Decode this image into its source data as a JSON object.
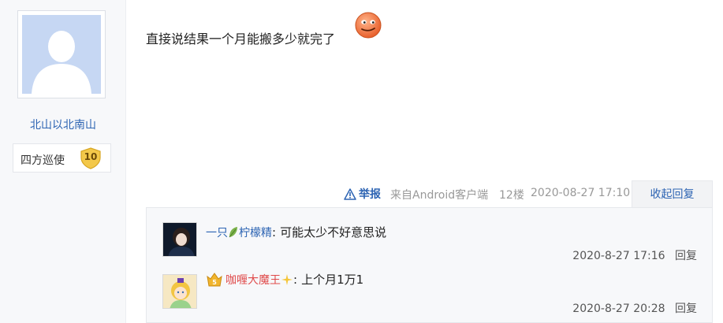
{
  "user": {
    "name": "北山以北南山",
    "level_title": "四方巡使",
    "level": "10"
  },
  "post": {
    "content": "直接说结果一个月能搬多少就完了",
    "report_label": "举报",
    "client": "来自Android客户端",
    "floor": "12楼",
    "time": "2020-08-27 17:10",
    "collapse_label": "收起回复"
  },
  "replies": [
    {
      "name_prefix": "一只",
      "name_suffix": "柠檬精",
      "separator": ":",
      "text": "可能太少不好意思说",
      "time": "2020-8-27 17:16",
      "reply_label": "回复"
    },
    {
      "name": "咖喱大魔王",
      "separator": ":",
      "text": "上个月1万1",
      "time": "2020-8-27 20:28",
      "reply_label": "回复"
    }
  ],
  "colors": {
    "link": "#2d64b3",
    "vip_name": "#e04b4b",
    "panel_bg": "#f7f8fa"
  },
  "icons": [
    "default-avatar-icon",
    "level-shield-icon",
    "emoji-face-icon",
    "warning-icon",
    "leaf-icon",
    "vip-badge-icon",
    "sparkle-icon"
  ]
}
